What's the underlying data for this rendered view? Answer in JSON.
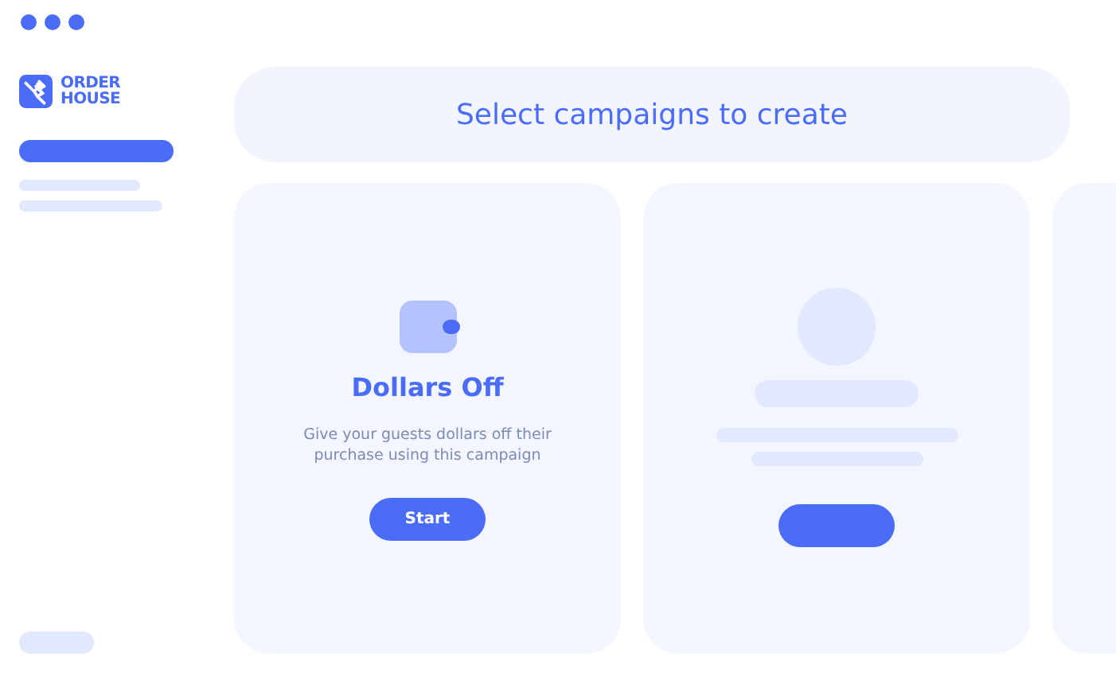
{
  "logo": "ORDER HOUSE",
  "header": {
    "title": "Select campaigns to create"
  },
  "cards": [
    {
      "kind": "campaign",
      "title": "Dollars Off",
      "description": "Give your guests dollars off their purchase using this campaign",
      "button": "Start"
    },
    {
      "kind": "skeleton"
    },
    {
      "kind": "partial"
    }
  ]
}
